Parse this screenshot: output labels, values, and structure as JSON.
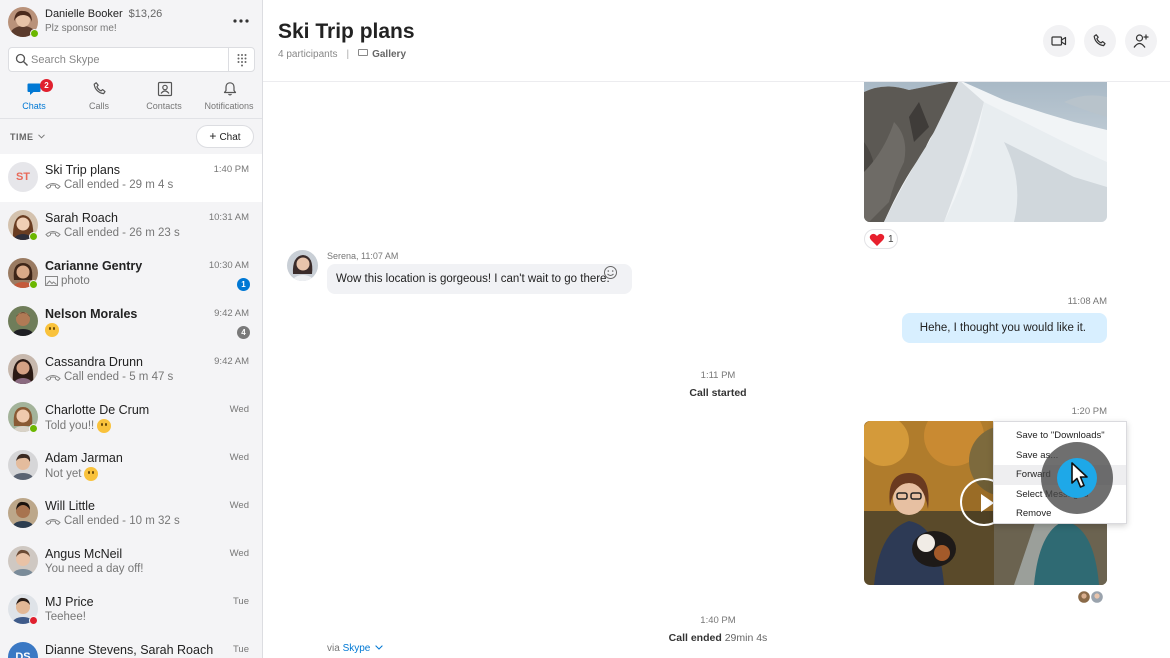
{
  "profile": {
    "name": "Danielle Booker",
    "credit": "$13,26",
    "mood": "Plz sponsor me!",
    "presence": "online"
  },
  "search": {
    "placeholder": "Search Skype"
  },
  "nav_tabs": [
    {
      "label": "Chats",
      "icon": "chat-icon",
      "badge": "2",
      "active": true
    },
    {
      "label": "Calls",
      "icon": "phone-icon"
    },
    {
      "label": "Contacts",
      "icon": "contacts-icon"
    },
    {
      "label": "Notifications",
      "icon": "bell-icon"
    }
  ],
  "list_controls": {
    "sort_label": "TIME",
    "new_chat_label": "Chat"
  },
  "chats": [
    {
      "name": "Ski Trip plans",
      "time": "1:40 PM",
      "preview": "Call ended - 29 m 4 s",
      "preview_icon": "call-icon",
      "initials": "ST",
      "selected": true
    },
    {
      "name": "Sarah Roach",
      "time": "10:31 AM",
      "preview": "Call ended - 26 m 23 s",
      "preview_icon": "call-icon",
      "presence": "online"
    },
    {
      "name": "Carianne Gentry",
      "time": "10:30 AM",
      "preview": "photo",
      "preview_icon": "photo-icon",
      "bold": true,
      "unread": "1",
      "unread_color": "#0078d4",
      "presence": "online"
    },
    {
      "name": "Nelson Morales",
      "time": "9:42 AM",
      "preview": "",
      "preview_icon": "emoji-icon",
      "bold": true,
      "unread": "4",
      "unread_color": "#7a7a7a"
    },
    {
      "name": "Cassandra Drunn",
      "time": "9:42 AM",
      "preview": "Call ended - 5 m 47 s",
      "preview_icon": "call-icon"
    },
    {
      "name": "Charlotte De Crum",
      "time": "Wed",
      "preview": "Told you!!",
      "preview_icon": "emoji-icon",
      "presence": "online"
    },
    {
      "name": "Adam Jarman",
      "time": "Wed",
      "preview": "Not yet",
      "preview_icon": "emoji-icon"
    },
    {
      "name": "Will Little",
      "time": "Wed",
      "preview": "Call ended - 10 m 32 s",
      "preview_icon": "call-icon"
    },
    {
      "name": "Angus McNeil",
      "time": "Wed",
      "preview": "You need a day off!"
    },
    {
      "name": "MJ Price",
      "time": "Tue",
      "preview": "Teehee!",
      "presence": "busy"
    },
    {
      "name": "Dianne Stevens, Sarah Roach",
      "time": "Tue",
      "preview": "",
      "initials": "DS"
    }
  ],
  "conversation": {
    "title": "Ski Trip plans",
    "participants": "4 participants",
    "gallery_label": "Gallery"
  },
  "header_actions": [
    {
      "name": "video-call-button",
      "icon": "video-icon"
    },
    {
      "name": "audio-call-button",
      "icon": "phone-icon"
    },
    {
      "name": "add-participant-button",
      "icon": "add-person-icon"
    }
  ],
  "messages": {
    "photo_reaction": {
      "emoji": "heart-icon",
      "count": "1"
    },
    "incoming": {
      "sender_line": "Serena, 11:07 AM",
      "text": "Wow this location is gorgeous! I can't wait to go there."
    },
    "outgoing": {
      "time": "11:08 AM",
      "text": "Hehe, I thought you would like it."
    },
    "call_started": {
      "time": "1:11 PM",
      "label": "Call started"
    },
    "video": {
      "time": "1:20 PM"
    },
    "call_ended": {
      "time": "1:40 PM",
      "label": "Call ended",
      "duration": "29min 4s"
    },
    "via": {
      "prefix": "via",
      "link": "Skype"
    }
  },
  "context_menu": {
    "items": [
      "Save to \"Downloads\"",
      "Save as...",
      "Forward",
      "Select Messages",
      "Remove"
    ],
    "hovered_index": 2
  },
  "colors": {
    "accent": "#0078d4",
    "outgoing_bubble": "#d8efff",
    "incoming_bubble": "#f1f2f5",
    "cursor": "#1ea8e8",
    "online": "#6bb700",
    "busy": "#e0202e"
  }
}
